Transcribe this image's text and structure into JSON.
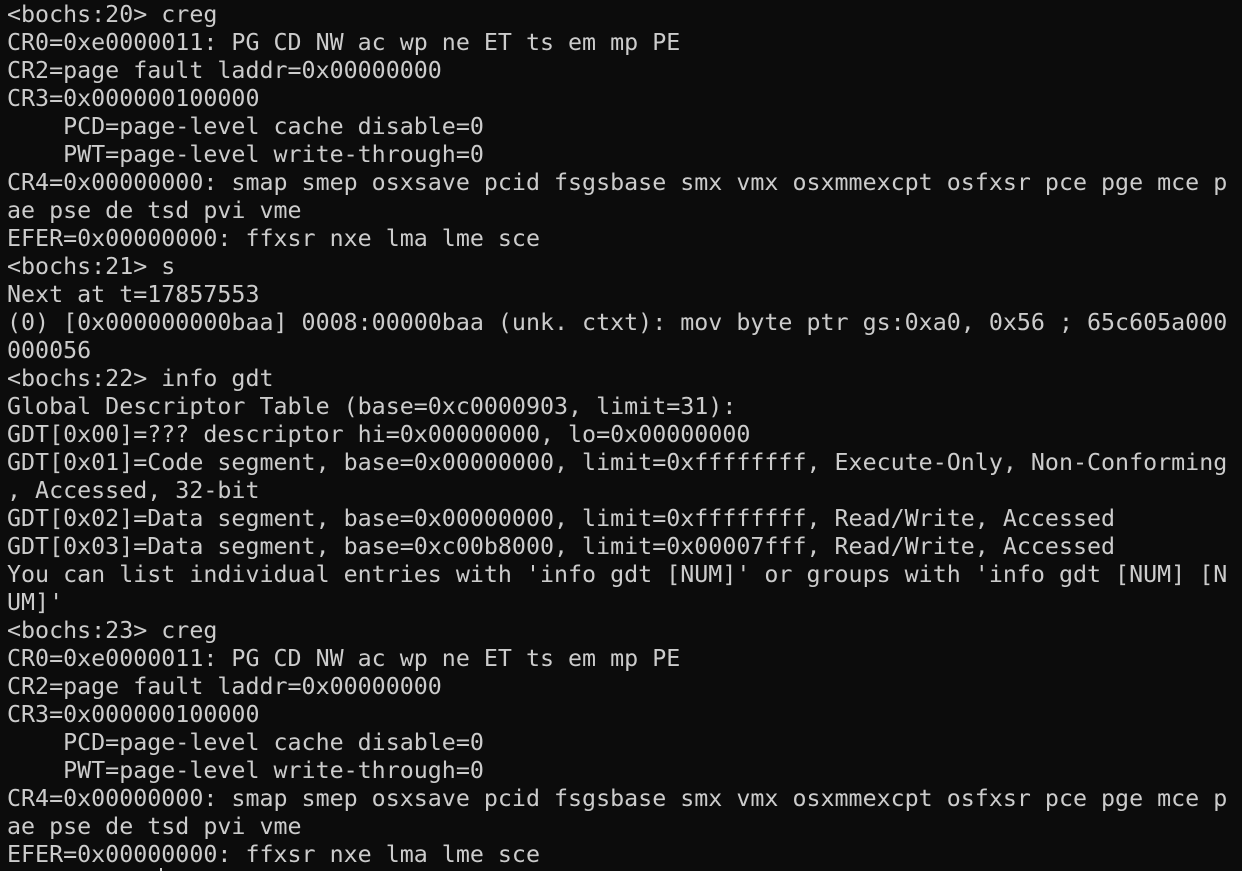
{
  "terminal": {
    "lines": [
      "<bochs:20> creg",
      "CR0=0xe0000011: PG CD NW ac wp ne ET ts em mp PE",
      "CR2=page fault laddr=0x00000000",
      "CR3=0x000000100000",
      "    PCD=page-level cache disable=0",
      "    PWT=page-level write-through=0",
      "CR4=0x00000000: smap smep osxsave pcid fsgsbase smx vmx osxmmexcpt osfxsr pce pge mce p",
      "ae pse de tsd pvi vme",
      "EFER=0x00000000: ffxsr nxe lma lme sce",
      "<bochs:21> s",
      "Next at t=17857553",
      "(0) [0x000000000baa] 0008:00000baa (unk. ctxt): mov byte ptr gs:0xa0, 0x56 ; 65c605a000",
      "000056",
      "<bochs:22> info gdt",
      "Global Descriptor Table (base=0xc0000903, limit=31):",
      "GDT[0x00]=??? descriptor hi=0x00000000, lo=0x00000000",
      "GDT[0x01]=Code segment, base=0x00000000, limit=0xffffffff, Execute-Only, Non-Conforming",
      ", Accessed, 32-bit",
      "GDT[0x02]=Data segment, base=0x00000000, limit=0xffffffff, Read/Write, Accessed",
      "GDT[0x03]=Data segment, base=0xc00b8000, limit=0x00007fff, Read/Write, Accessed",
      "You can list individual entries with 'info gdt [NUM]' or groups with 'info gdt [NUM] [N",
      "UM]'",
      "<bochs:23> creg",
      "CR0=0xe0000011: PG CD NW ac wp ne ET ts em mp PE",
      "CR2=page fault laddr=0x00000000",
      "CR3=0x000000100000",
      "    PCD=page-level cache disable=0",
      "    PWT=page-level write-through=0",
      "CR4=0x00000000: smap smep osxsave pcid fsgsbase smx vmx osxmmexcpt osfxsr pce pge mce p",
      "ae pse de tsd pvi vme",
      "EFER=0x00000000: ffxsr nxe lma lme sce"
    ],
    "colors": {
      "background": "#0c0c0c",
      "foreground": "#cccccc"
    }
  }
}
